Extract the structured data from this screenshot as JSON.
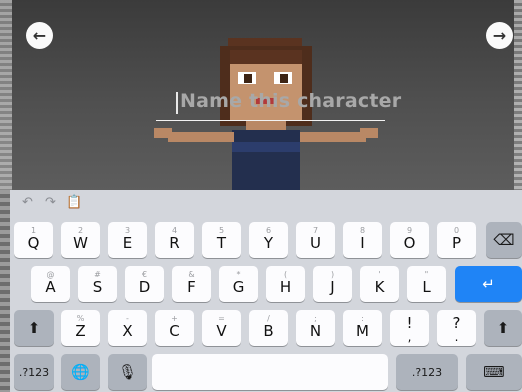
{
  "scene": {
    "back_icon": "arrow-left-icon",
    "next_icon": "arrow-right-icon",
    "back_glyph": "←",
    "next_glyph": "→",
    "name_placeholder": "Name this character"
  },
  "keyboard": {
    "shortcuts": {
      "undo": "↶",
      "redo": "↷",
      "paste": "📋"
    },
    "row1": [
      {
        "main": "Q",
        "alt": "1"
      },
      {
        "main": "W",
        "alt": "2"
      },
      {
        "main": "E",
        "alt": "3"
      },
      {
        "main": "R",
        "alt": "4"
      },
      {
        "main": "T",
        "alt": "5"
      },
      {
        "main": "Y",
        "alt": "6"
      },
      {
        "main": "U",
        "alt": "7"
      },
      {
        "main": "I",
        "alt": "8"
      },
      {
        "main": "O",
        "alt": "9"
      },
      {
        "main": "P",
        "alt": "0"
      }
    ],
    "row2": [
      {
        "main": "A",
        "alt": "@"
      },
      {
        "main": "S",
        "alt": "#"
      },
      {
        "main": "D",
        "alt": "€"
      },
      {
        "main": "F",
        "alt": "&"
      },
      {
        "main": "G",
        "alt": "*"
      },
      {
        "main": "H",
        "alt": "("
      },
      {
        "main": "J",
        "alt": ")"
      },
      {
        "main": "K",
        "alt": "'"
      },
      {
        "main": "L",
        "alt": "\""
      }
    ],
    "row3": [
      {
        "main": "Z",
        "alt": "%"
      },
      {
        "main": "X",
        "alt": "-"
      },
      {
        "main": "C",
        "alt": "+"
      },
      {
        "main": "V",
        "alt": "="
      },
      {
        "main": "B",
        "alt": "/"
      },
      {
        "main": "N",
        "alt": ";"
      },
      {
        "main": "M",
        "alt": ":"
      },
      {
        "main": "!",
        "alt": ""
      },
      {
        "main": "?",
        "alt": ""
      }
    ],
    "row3_sub": [
      ",",
      "."
    ],
    "numbers_left": ".?123",
    "numbers_right": ".?123",
    "delete_glyph": "⌫",
    "return_glyph": "↵",
    "shift_glyph": "⬆",
    "globe_glyph": "🌐",
    "mic_glyph": "🎙",
    "hide_glyph": "⌨"
  }
}
